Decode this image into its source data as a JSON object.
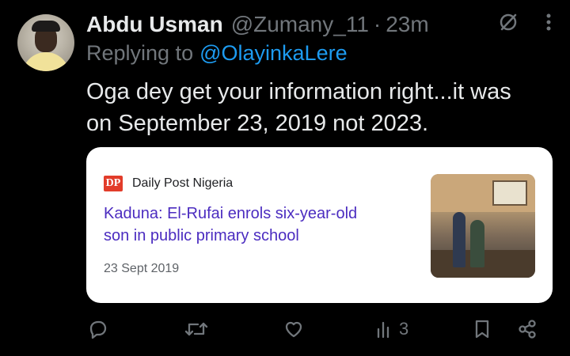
{
  "tweet": {
    "author_name": "Abdu Usman",
    "handle": "@Zumany_11",
    "separator": "·",
    "time": "23m",
    "replying_to_label": "Replying to",
    "replying_to_handle": "@OlayinkaLere",
    "text_line1": "Oga dey get your information right...it was",
    "text_line2": "on September 23, 2019 not 2023."
  },
  "link_card": {
    "source_logo": "DP",
    "source_name": "Daily Post Nigeria",
    "headline_line1": "Kaduna: El-Rufai enrols six-year-old",
    "headline_line2": "son in public primary school",
    "date": "23 Sept 2019"
  },
  "actions": {
    "views_count": "3"
  },
  "colors": {
    "background": "#000000",
    "text_primary": "#e7e9ea",
    "text_secondary": "#71767b",
    "accent": "#1d9bf0",
    "headline": "#4b2cc0"
  },
  "icons": [
    "grok-icon",
    "more-icon",
    "reply-icon",
    "retweet-icon",
    "like-icon",
    "views-icon",
    "bookmark-icon",
    "share-icon"
  ]
}
